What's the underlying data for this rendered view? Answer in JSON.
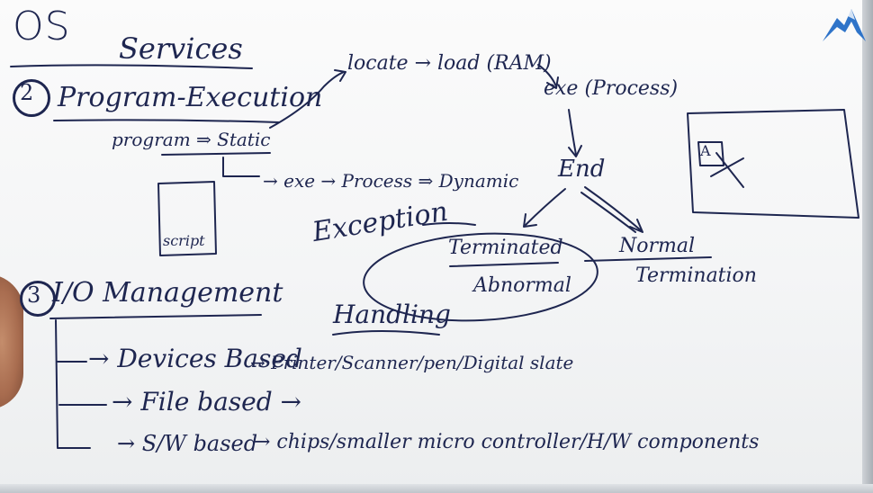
{
  "board": {
    "title": "OS",
    "subtitle": "Services",
    "section2": {
      "number": "2",
      "heading": "Program-Execution",
      "static_line": "program ⇒ Static",
      "exe_line": "→ exe → Process ⇒ Dynamic",
      "box_label": "script"
    },
    "flow": {
      "locate": "locate → load (RAM)",
      "exe_process": "exe (Process)",
      "end": "End",
      "exception": "Exception",
      "terminated": "Terminated",
      "abnormal": "Abnormal",
      "normal": "Normal",
      "termination": "Termination",
      "handling": "Handling"
    },
    "sketch": {
      "label": "A"
    },
    "section3": {
      "number": "3",
      "heading": "I/O Management",
      "devices": "→ Devices Based",
      "device_list": "→ Printer/Scanner/pen/Digital slate",
      "file": "→ File based →",
      "sw": "→ S/W based",
      "chips": "→ chips/smaller micro controller/H/W components"
    }
  },
  "icons": {
    "logo": "blue-mountain-logo-icon"
  },
  "colors": {
    "ink": "#1e2650",
    "board": "#f8f9fa",
    "logo": "#2f74c9"
  }
}
